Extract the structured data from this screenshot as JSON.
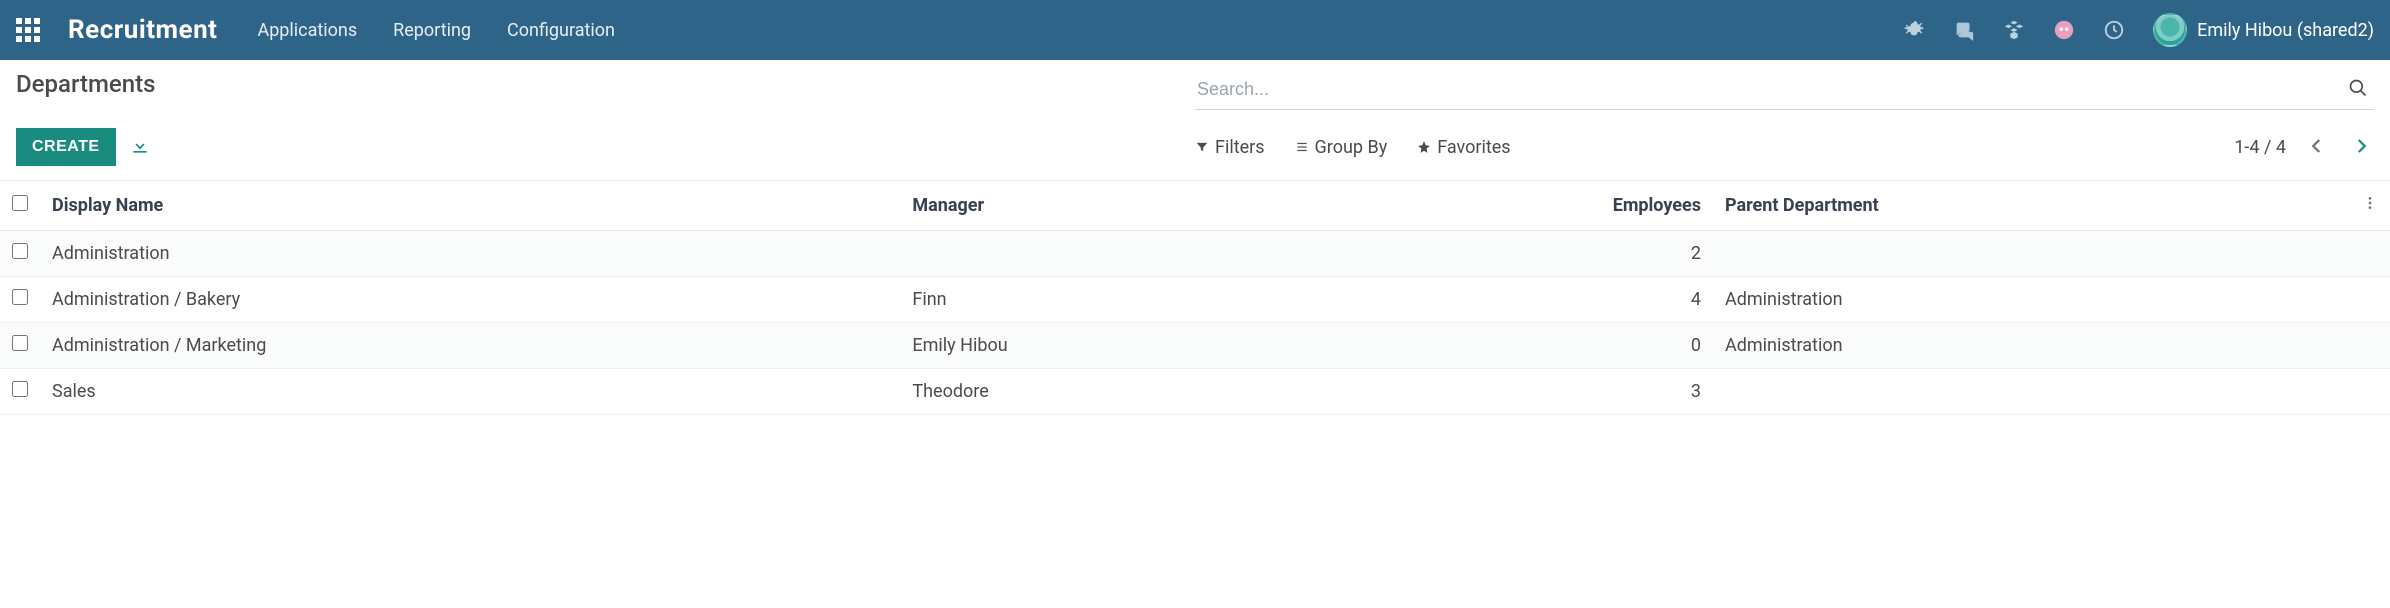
{
  "header": {
    "brand": "Recruitment",
    "menu": [
      "Applications",
      "Reporting",
      "Configuration"
    ],
    "user_name": "Emily Hibou (shared2)"
  },
  "page": {
    "title": "Departments",
    "create_label": "CREATE",
    "search_placeholder": "Search..."
  },
  "toolbar": {
    "filters": "Filters",
    "group_by": "Group By",
    "favorites": "Favorites",
    "pager": "1-4 / 4"
  },
  "table": {
    "columns": {
      "display_name": "Display Name",
      "manager": "Manager",
      "employees": "Employees",
      "parent_department": "Parent Department"
    },
    "rows": [
      {
        "display_name": "Administration",
        "manager": "",
        "employees": "2",
        "parent_department": ""
      },
      {
        "display_name": "Administration / Bakery",
        "manager": "Finn",
        "employees": "4",
        "parent_department": "Administration"
      },
      {
        "display_name": "Administration / Marketing",
        "manager": "Emily Hibou",
        "employees": "0",
        "parent_department": "Administration"
      },
      {
        "display_name": "Sales",
        "manager": "Theodore",
        "employees": "3",
        "parent_department": ""
      }
    ]
  }
}
